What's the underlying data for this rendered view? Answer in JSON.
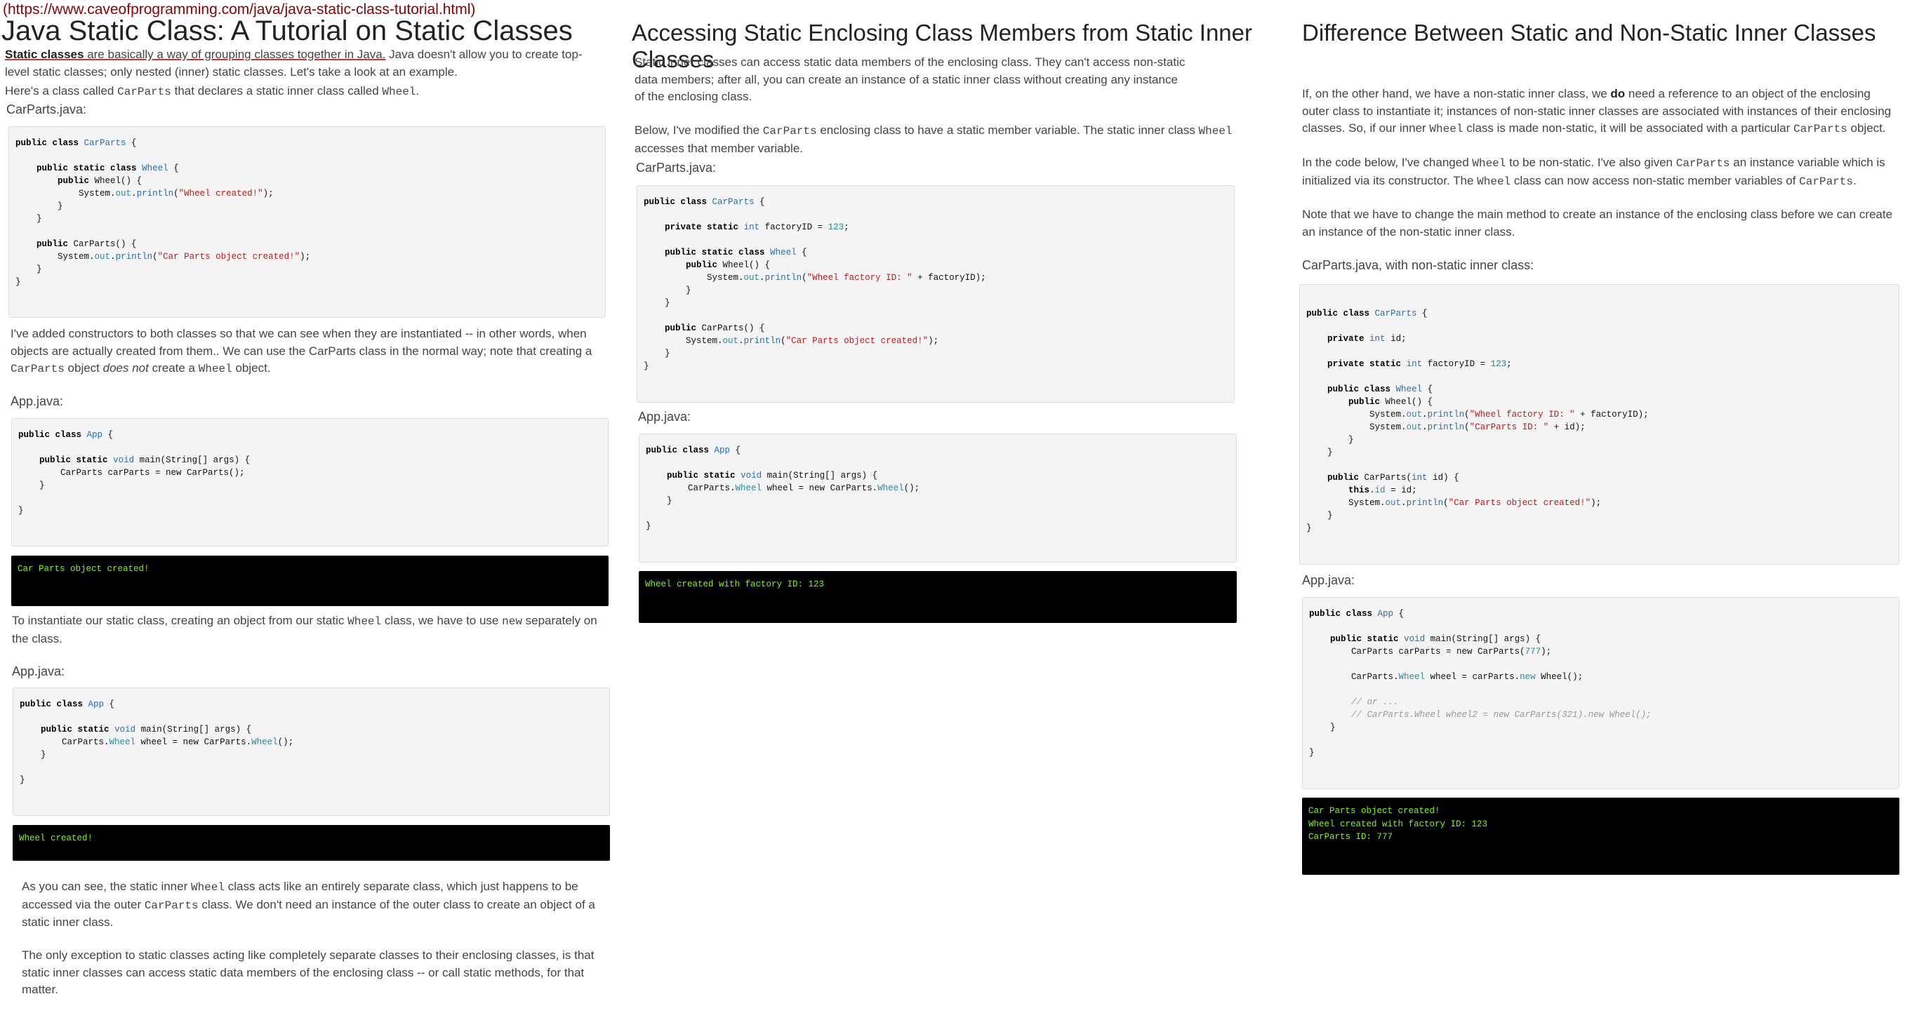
{
  "url": "(https://www.caveofprogramming.com/java/java-static-class-tutorial.html)",
  "col1": {
    "title": "Java Static Class: A Tutorial on Static Classes",
    "intro_link": "Static classes",
    "intro_mid": " are basically a way of grouping classes together in Java.",
    "intro_rest": " Java doesn't allow you to create top-level static classes; only nested (inner) static classes. Let's take a look at an example.",
    "p2_a": "Here's a class called ",
    "p2_code1": "CarParts",
    "p2_b": " that declares a static inner class called ",
    "p2_code2": "Wheel",
    "p2_c": ".",
    "label_carparts": "CarParts.java:",
    "p3_a": "I've added constructors to both classes so that we can see when they are instantiated -- in other words, when objects are actually created from them.. We can use the CarParts class in the normal way; note that creating a ",
    "p3_code1": "CarParts",
    "p3_b": " object ",
    "p3_em": "does not",
    "p3_c": " create a ",
    "p3_code2": "Wheel",
    "p3_d": " object.",
    "label_app1": "App.java:",
    "output1": "Car Parts object created!",
    "p4_a": "To instantiate our static class, creating an object from our static ",
    "p4_code1": "Wheel",
    "p4_b": " class, we have to use ",
    "p4_code2": "new",
    "p4_c": " separately on the class.",
    "label_app2": "App.java:",
    "output2": "Wheel created!",
    "p5_a": "As you can see, the static inner ",
    "p5_code1": "Wheel",
    "p5_b": " class acts like an entirely separate class, which just happens to be accessed via the outer ",
    "p5_code2": "CarParts",
    "p5_c": " class. We don't need an instance of the outer class to create an object of a static inner class.",
    "p6": "The only exception to static classes acting like completely separate classes to their enclosing classes, is that static inner classes can access static data members of the enclosing class -- or call static methods, for that matter."
  },
  "col2": {
    "title": "Accessing Static Enclosing Class Members from Static Inner Classes",
    "p1": "Static inner classes can access static data members of the enclosing class. They can't access non-static data members; after all, you can create an instance of a static inner class without creating any instance of the enclosing class.",
    "p2_a": "Below, I've modified the ",
    "p2_code1": "CarParts",
    "p2_b": " enclosing class to have a static member variable. The static inner class ",
    "p2_code2": "Wheel",
    "p2_c": " accesses that member variable.",
    "label_carparts": "CarParts.java:",
    "label_app": "App.java:",
    "output": "Wheel created with factory ID: 123"
  },
  "col3": {
    "title": "Difference Between Static and Non-Static Inner Classes",
    "p1_a": "If, on the other hand, we have a non-static inner class, we ",
    "p1_b": "do",
    "p1_c": " need a reference to an object of the enclosing outer class to instantiate it; instances of non-static inner classes are associated with instances of their enclosing classes. So, if our inner ",
    "p1_code1": "Wheel",
    "p1_d": " class is made non-static, it will be associated with a particular ",
    "p1_code2": "CarParts",
    "p1_e": " object.",
    "p2_a": "In the code below, I've changed ",
    "p2_code1": "Wheel",
    "p2_b": " to be non-static. I've also given ",
    "p2_code2": "CarParts",
    "p2_c": " an instance variable which is initialized via its constructor. The ",
    "p2_code3": "Wheel",
    "p2_d": " class can now access non-static member variables of ",
    "p2_code4": "CarParts",
    "p2_e": ".",
    "p3": "Note that we have to change the main method to create an instance of the enclosing class before we can create an instance of the non-static inner class.",
    "label_carparts": "CarParts.java, with non-static inner class:",
    "label_app": "App.java:",
    "output": "Car Parts object created!\nWheel created with factory ID: 123\nCarParts ID: 777"
  }
}
